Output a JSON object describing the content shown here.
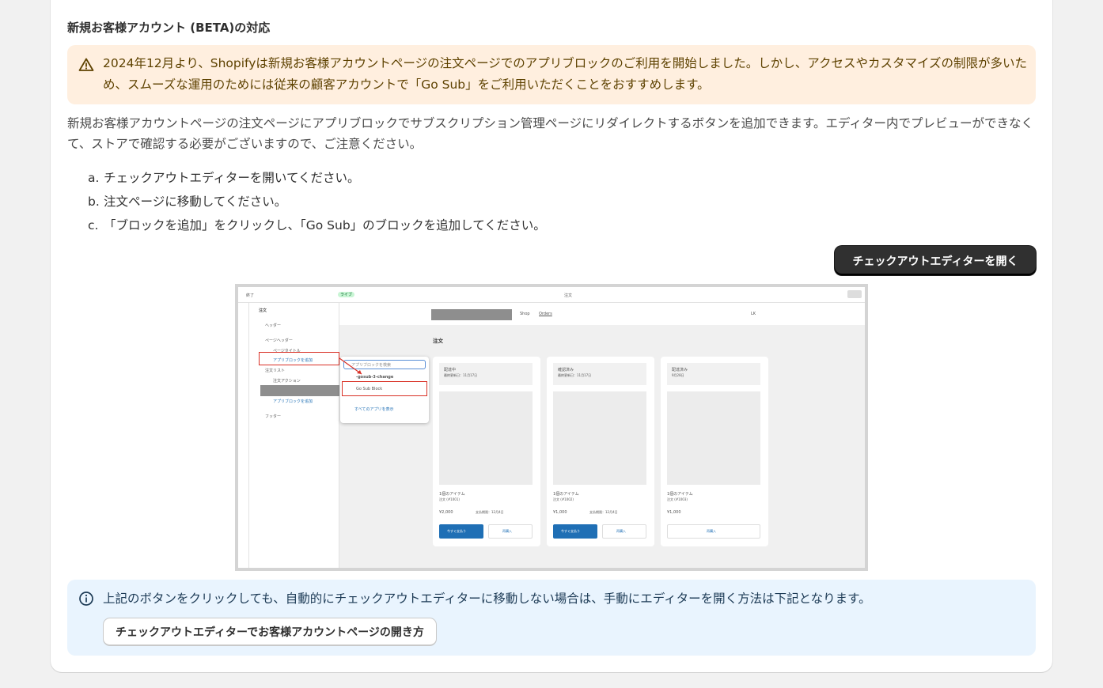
{
  "section": {
    "title": "新規お客様アカウント (BETA)の対応",
    "warning": "2024年12月より、Shopifyは新規お客様アカウントページの注文ページでのアプリブロックのご利用を開始しました。しかし、アクセスやカスタマイズの制限が多いため、スムーズな運用のためには従来の顧客アカウントで「Go Sub」をご利用いただくことをおすすめします。",
    "warning_icon": "alert-triangle-icon",
    "description": "新規お客様アカウントページの注文ページにアプリブロックでサブスクリプション管理ページにリダイレクトするボタンを追加できます。エディター内でプレビューができなくて、ストアで確認する必要がございますので、ご注意ください。",
    "steps": [
      {
        "mark": "a.",
        "text": "チェックアウトエディターを開いてください。"
      },
      {
        "mark": "b.",
        "text": "注文ページに移動してください。"
      },
      {
        "mark": "c.",
        "text": "「ブロックを追加」をクリックし、「Go Sub」のブロックを追加してください。"
      }
    ],
    "primary_button": "チェックアウトエディターを開く",
    "info_icon": "info-circle-icon",
    "info_text": "上記のボタンをクリックしても、自動的にチェックアウトエディターに移動しない場合は、手動にエディターを開く方法は下記となります。",
    "secondary_button": "チェックアウトエディターでお客様アカウントページの開き方"
  },
  "screenshot": {
    "top_left": "終了",
    "live_badge": "ライブ",
    "center_title": "注文",
    "panel_title": "注文",
    "panel_items": [
      "ヘッダー",
      "ページヘッダー",
      "ページタイトル",
      "アプリブロックを追加",
      "注文リスト",
      "注文アクション",
      "アプリブロックを追加",
      "フッター"
    ],
    "popover_search": "アプリブロックを検索",
    "popover_app": "-gosub-3-change",
    "popover_block": "Go Sub Block",
    "popover_footer": "すべてのアプリを表示",
    "nav_shop": "Shop",
    "nav_orders": "Orders",
    "nav_account": "LK",
    "page_title": "注文",
    "cards": [
      {
        "status": "配達中",
        "sub": "最終更新日：11月17日",
        "items": "1個のアイテム",
        "order": "注文 (#1001)",
        "price": "¥2,000",
        "due": "支払期限：12月4日",
        "pay": "今すぐ支払う",
        "rebuy": "再購入"
      },
      {
        "status": "確認済み",
        "sub": "最終更新日：11月17日",
        "items": "1個のアイテム",
        "order": "注文 (#1002)",
        "price": "¥1,000",
        "due": "支払期限：12月4日",
        "pay": "今すぐ支払う",
        "rebuy": "再購入"
      },
      {
        "status": "配達済み",
        "sub": "9月28日",
        "items": "1個のアイテム",
        "order": "注文 (#1003)",
        "price": "¥1,000",
        "due": "",
        "pay": "",
        "rebuy": "再購入"
      }
    ]
  },
  "colors": {
    "warning_bg": "#ffefdf",
    "info_bg": "#e9f4fe",
    "primary_btn": "#303030",
    "highlight": "#d93025"
  }
}
